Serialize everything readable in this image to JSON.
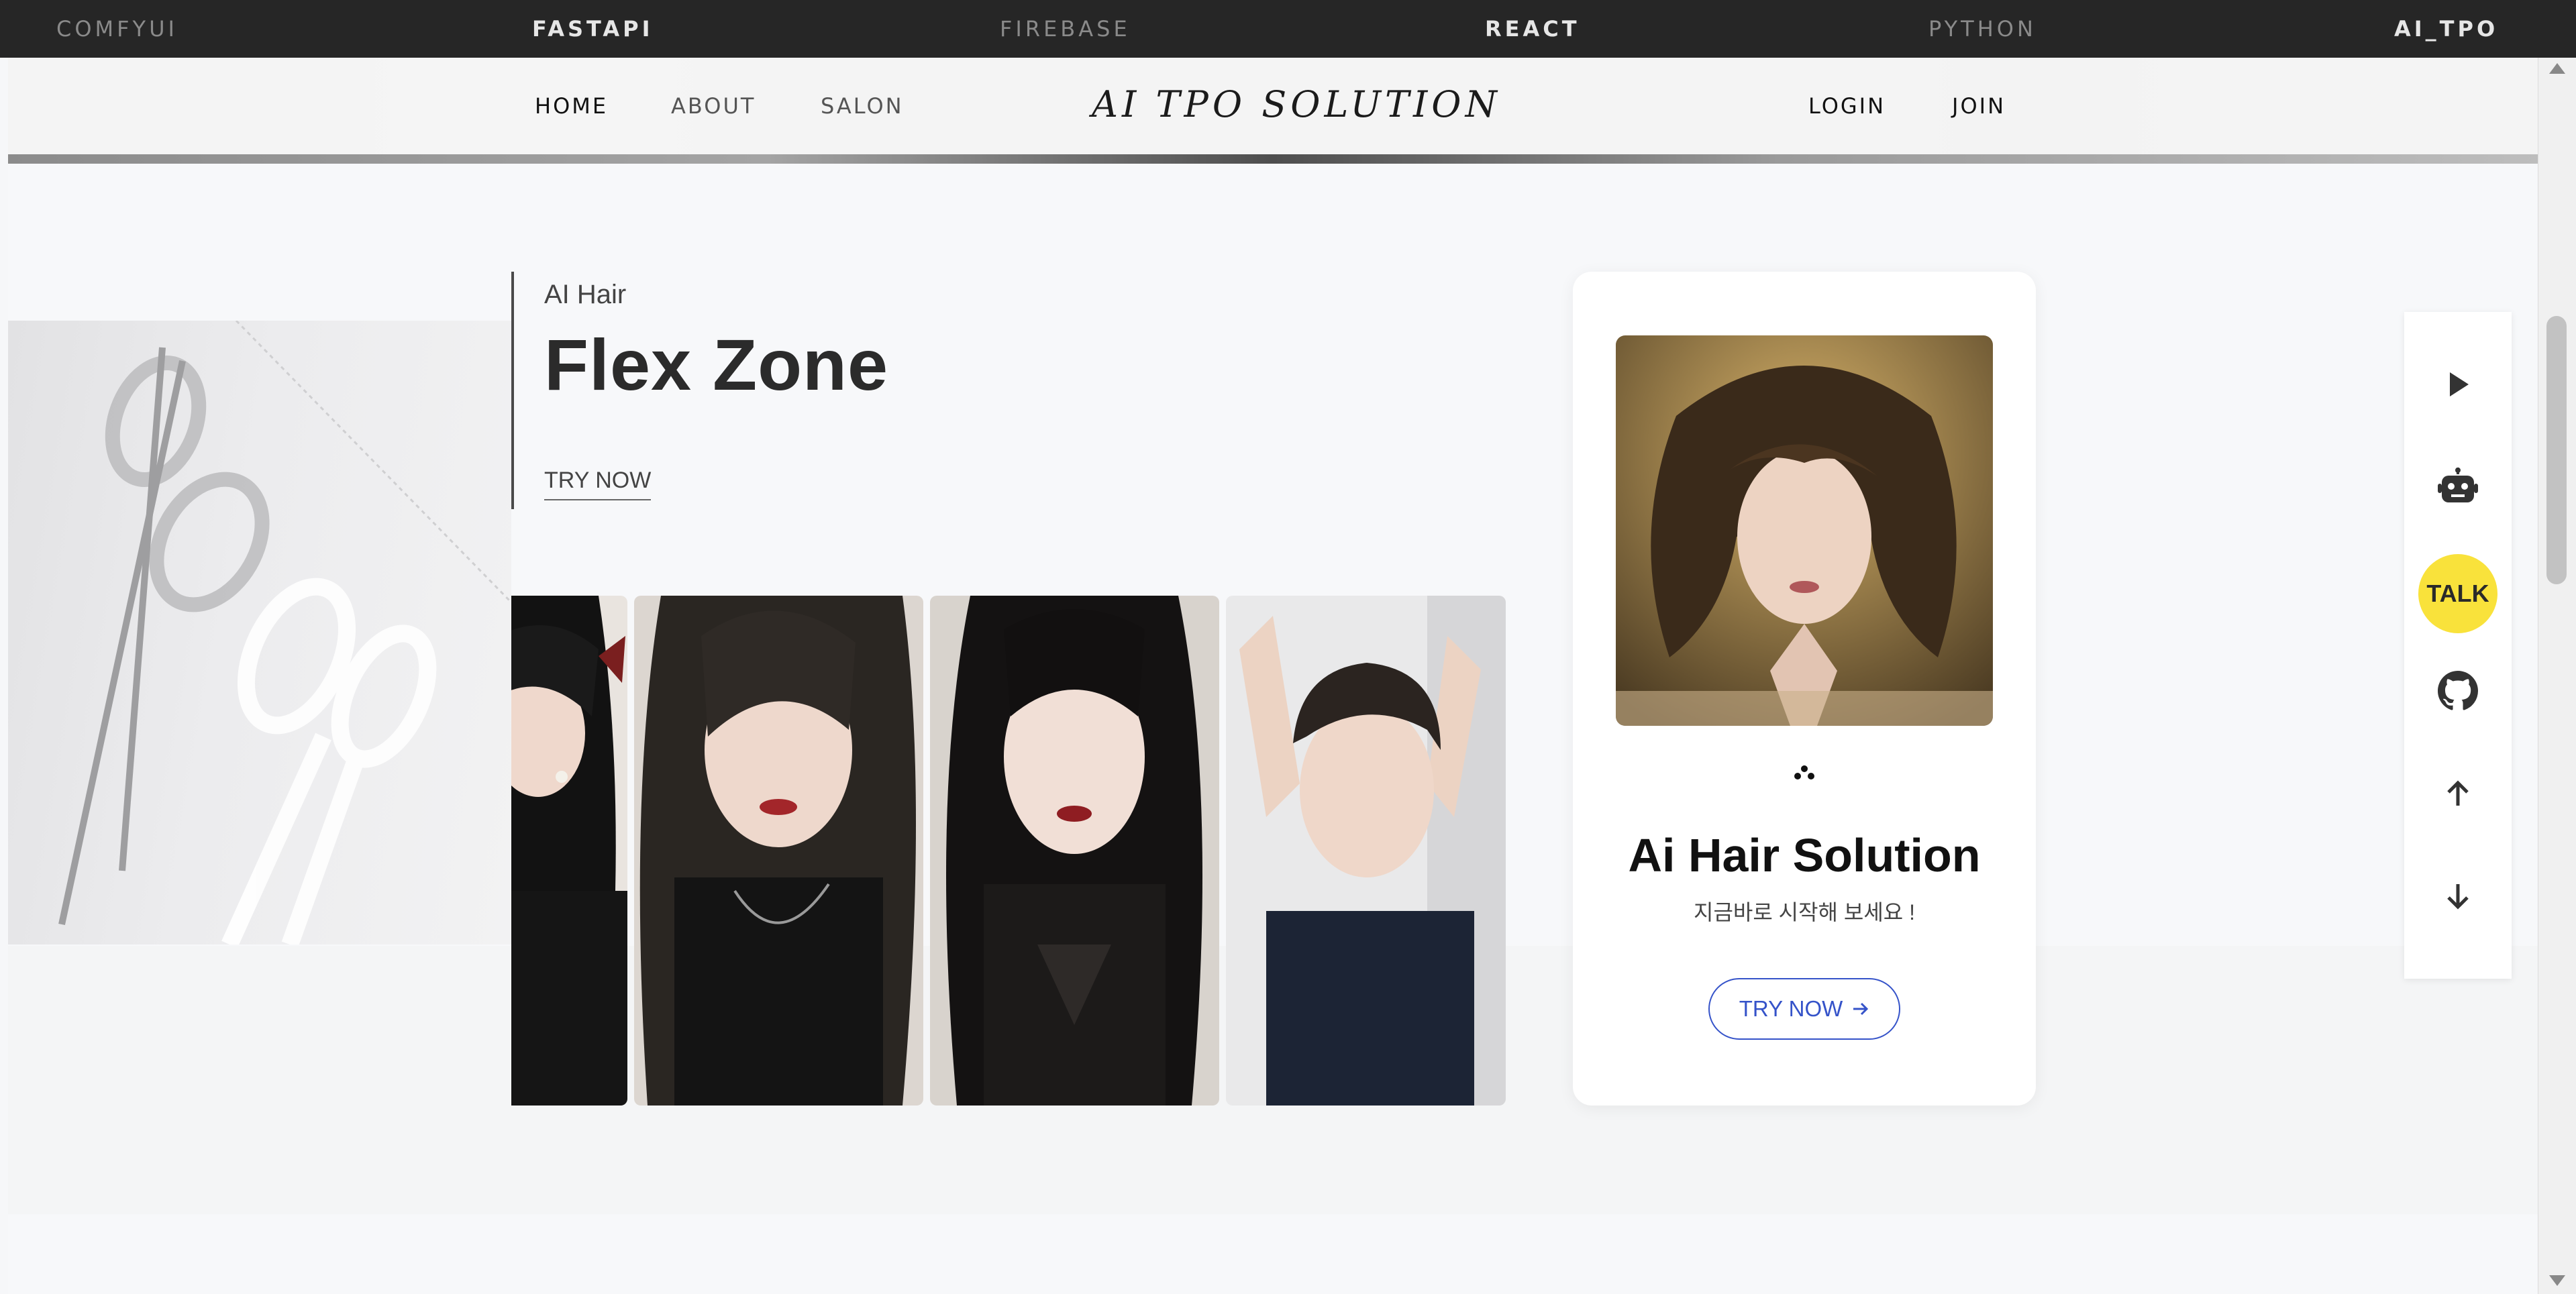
{
  "techbar": {
    "items": [
      {
        "label": "COMFYUI",
        "style": "dim"
      },
      {
        "label": "FASTAPI",
        "style": "bright"
      },
      {
        "label": "FIREBASE",
        "style": "dim"
      },
      {
        "label": "REACT",
        "style": "bright"
      },
      {
        "label": "PYTHON",
        "style": "dim"
      },
      {
        "label": "AI_TPO",
        "style": "bright"
      }
    ]
  },
  "nav": {
    "home": "HOME",
    "about": "ABOUT",
    "salon": "SALON",
    "brand": "AI TPO SOLUTION",
    "login": "LOGIN",
    "join": "JOIN"
  },
  "intro": {
    "subtitle": "AI Hair",
    "title": "Flex Zone",
    "cta": "TRY NOW"
  },
  "card": {
    "title": "Ai Hair Solution",
    "subtitle": "지금바로 시작해 보세요 !",
    "button": "TRY NOW"
  },
  "quick": {
    "talk": "TALK",
    "icons": [
      "play-icon",
      "robot-icon",
      "talk-button",
      "github-icon",
      "arrow-up-icon",
      "arrow-down-icon"
    ]
  },
  "colors": {
    "techbar_bg": "#262626",
    "talk_yellow": "#f9e23b",
    "cta_blue": "#3553c9"
  }
}
